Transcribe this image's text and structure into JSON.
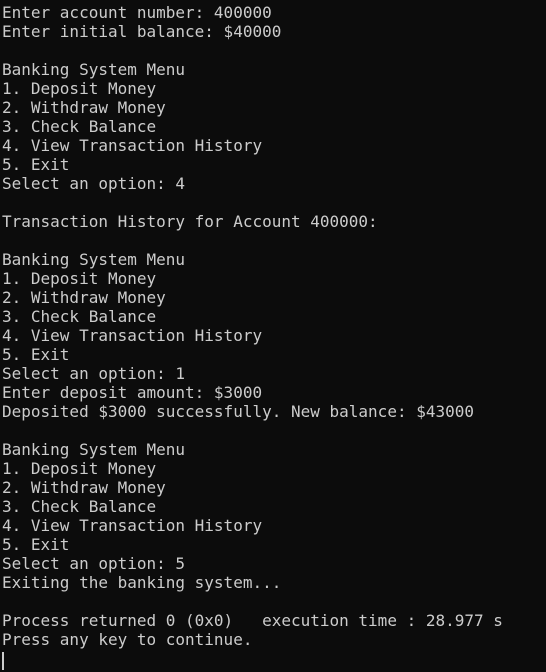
{
  "terminal": {
    "lines": [
      "Enter account number: 400000",
      "Enter initial balance: $40000",
      "",
      "Banking System Menu",
      "1. Deposit Money",
      "2. Withdraw Money",
      "3. Check Balance",
      "4. View Transaction History",
      "5. Exit",
      "Select an option: 4",
      "",
      "Transaction History for Account 400000:",
      "",
      "Banking System Menu",
      "1. Deposit Money",
      "2. Withdraw Money",
      "3. Check Balance",
      "4. View Transaction History",
      "5. Exit",
      "Select an option: 1",
      "Enter deposit amount: $3000",
      "Deposited $3000 successfully. New balance: $43000",
      "",
      "Banking System Menu",
      "1. Deposit Money",
      "2. Withdraw Money",
      "3. Check Balance",
      "4. View Transaction History",
      "5. Exit",
      "Select an option: 5",
      "Exiting the banking system...",
      "",
      "Process returned 0 (0x0)   execution time : 28.977 s",
      "Press any key to continue."
    ]
  }
}
